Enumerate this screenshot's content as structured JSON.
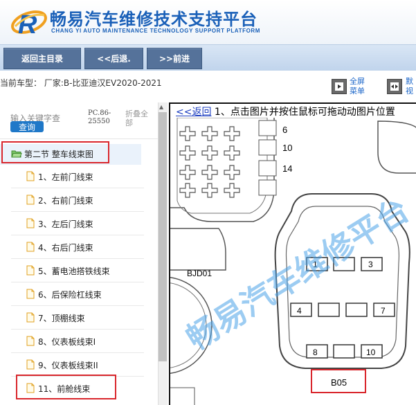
{
  "header": {
    "title": "畅易汽车维修技术支持平台",
    "subtitle": "CHANG YI AUTO MAINTENANCE TECHNOLOGY SUPPORT PLATFORM",
    "brand_color": "#1a60b8"
  },
  "nav": {
    "home": "返回主目录",
    "back": "<<后退.",
    "forward": ">>前进"
  },
  "info": {
    "car_model": "当前车型： 厂家:B-比亚迪汉EV2020-2021",
    "fullscreen_label": "全屏",
    "fullscreen_label2": "菜单",
    "default_label": "默",
    "default_label2": "视"
  },
  "sidebar": {
    "search_hint": "输入关键字查",
    "search_button": "查询",
    "pc_code_1": "PC.86-",
    "pc_code_2": "25550",
    "collapse_1": "折叠全",
    "collapse_2": "部",
    "section": "第二节 整车线束图",
    "items": [
      {
        "label": "1、左前门线束"
      },
      {
        "label": "2、右前门线束"
      },
      {
        "label": "3、左后门线束"
      },
      {
        "label": "4、右后门线束"
      },
      {
        "label": "5、蓄电池搭铁线束"
      },
      {
        "label": "6、后保险杠线束"
      },
      {
        "label": "7、顶棚线束"
      },
      {
        "label": "8、仪表板线束I"
      },
      {
        "label": "9、仪表板线束II"
      },
      {
        "label": "11、前舱线束"
      }
    ]
  },
  "content": {
    "back_link": "<<返回",
    "instruction": " 1、点击图片并按住鼠标可拖动动图片位置",
    "connector_left_label": "BJD01",
    "connector_label": "B05",
    "pins_left": [
      "6",
      "10",
      "14"
    ],
    "pins_right": [
      "1",
      "3",
      "4",
      "7",
      "8",
      "10"
    ],
    "watermark": "畅易汽车维修平台"
  },
  "colors": {
    "nav_button": "#55729a",
    "link": "#1b66c9",
    "highlight": "#d9262c",
    "watermark": "#4aa3e8"
  }
}
